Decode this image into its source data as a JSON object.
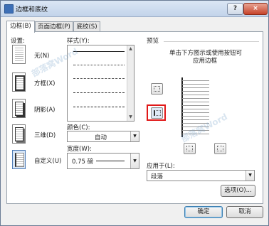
{
  "window": {
    "title": "边框和底纹",
    "help_label": "?",
    "close_label": "×"
  },
  "tabs": [
    {
      "label": "边框(B)",
      "active": true
    },
    {
      "label": "页面边框(P)",
      "active": false
    },
    {
      "label": "底纹(S)",
      "active": false
    }
  ],
  "settings": {
    "heading": "设置:",
    "items": [
      {
        "label": "无(N)"
      },
      {
        "label": "方框(X)"
      },
      {
        "label": "阴影(A)"
      },
      {
        "label": "三维(D)"
      },
      {
        "label": "自定义(U)",
        "selected": true
      }
    ]
  },
  "style": {
    "heading": "样式(Y):"
  },
  "color": {
    "heading": "颜色(C):",
    "value": "自动"
  },
  "width": {
    "heading": "宽度(W):",
    "value": "0.75 磅"
  },
  "preview": {
    "heading": "预览",
    "hint_line1": "单击下方图示或使用按钮可",
    "hint_line2": "应用边框"
  },
  "apply_to": {
    "heading": "应用于(L):",
    "value": "段落"
  },
  "buttons": {
    "options": "选项(O)...",
    "ok": "确定",
    "cancel": "取消"
  },
  "watermark": "部落窝Word",
  "colors": {
    "highlight": "#e01818",
    "titlebar": "#c2d3ea"
  }
}
